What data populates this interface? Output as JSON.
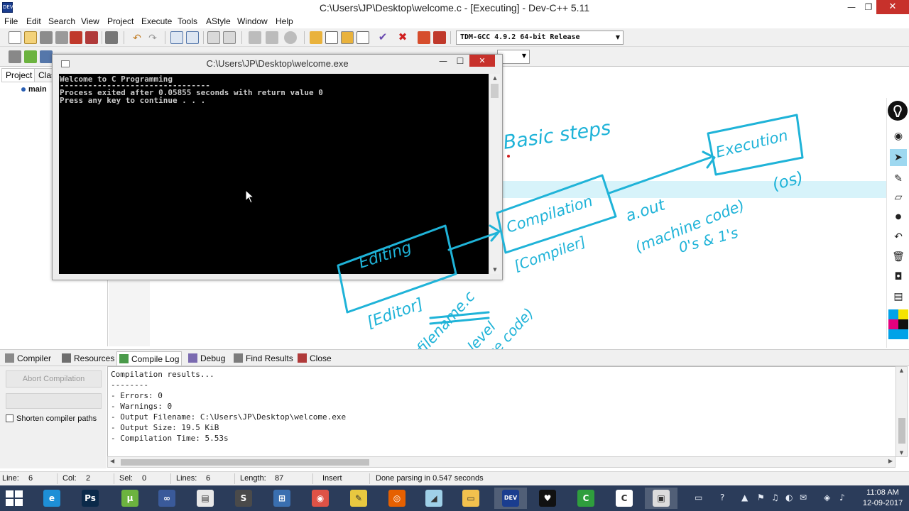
{
  "window": {
    "title": "C:\\Users\\JP\\Desktop\\welcome.c - [Executing] - Dev-C++ 5.11",
    "icon_label": "DEV",
    "minimize": "—",
    "maximize": "❐",
    "close": "✕"
  },
  "menu": [
    "File",
    "Edit",
    "Search",
    "View",
    "Project",
    "Execute",
    "Tools",
    "AStyle",
    "Window",
    "Help"
  ],
  "toolbar": {
    "compiler_select": "TDM-GCC 4.9.2 64-bit Release",
    "compiler_arrow": "▼",
    "second_arrow": "▼"
  },
  "left_panel": {
    "tabs": [
      "Project",
      "Clas"
    ],
    "tree_item": "main"
  },
  "console": {
    "title": "C:\\Users\\JP\\Desktop\\welcome.exe",
    "minimize": "—",
    "maximize": "☐",
    "close": "✕",
    "lines": [
      "Welcome to C Programming",
      "--------------------------------",
      "Process exited after 0.05855 seconds with return value 0",
      "Press any key to continue . . ."
    ]
  },
  "annotations": {
    "heading": "Basic steps",
    "editing": "Editing",
    "editor": "[Editor]",
    "compilation": "Compilation",
    "compiler": "[Compiler]",
    "execution": "Execution",
    "os": "(os)",
    "aout": "a.out",
    "machine_code": "(machine code)",
    "binary": "0's & 1's",
    "filename": "filename.c",
    "high_level": "(high-level",
    "source_code": "source code)",
    "ink_color": "#1fb3d8"
  },
  "pen_tools": {
    "icons": [
      "eye-icon",
      "pointer-icon",
      "pen-icon",
      "eraser-icon",
      "dot-icon",
      "undo-icon",
      "trash-icon",
      "camera-icon",
      "clipboard-icon"
    ],
    "swatches": [
      "#f5e400",
      "#e5007e",
      "#111111",
      "#00a2e8"
    ]
  },
  "bottom_tabs": [
    "Compiler",
    "Resources",
    "Compile Log",
    "Debug",
    "Find Results",
    "Close"
  ],
  "bottom_left": {
    "abort_label": "Abort Compilation",
    "shorten_label": "Shorten compiler paths",
    "progress_fraction": 0
  },
  "compile_log": [
    "Compilation results...",
    "--------",
    "- Errors: 0",
    "- Warnings: 0",
    "- Output Filename: C:\\Users\\JP\\Desktop\\welcome.exe",
    "- Output Size: 19.5 KiB",
    "- Compilation Time: 5.53s"
  ],
  "status": {
    "line_label": "Line:",
    "line_value": "6",
    "col_label": "Col:",
    "col_value": "2",
    "sel_label": "Sel:",
    "sel_value": "0",
    "lines_label": "Lines:",
    "lines_value": "6",
    "length_label": "Length:",
    "length_value": "87",
    "mode": "Insert",
    "message": "Done parsing in 0.547 seconds"
  },
  "taskbar": {
    "apps": [
      {
        "name": "internet-explorer",
        "glyph": "e",
        "color": "#1e8fd6"
      },
      {
        "name": "photoshop",
        "glyph": "Ps",
        "color": "#0b2a4a"
      },
      {
        "name": "utorrent",
        "glyph": "µ",
        "color": "#6cb33f"
      },
      {
        "name": "infinity-app",
        "glyph": "∞",
        "color": "#3a5a9a"
      },
      {
        "name": "chart-app",
        "glyph": "▤",
        "color": "#e8e8e8"
      },
      {
        "name": "sublime-text",
        "glyph": "S",
        "color": "#4a4a4a"
      },
      {
        "name": "network-app",
        "glyph": "⊞",
        "color": "#3a6fb0"
      },
      {
        "name": "chrome",
        "glyph": "◉",
        "color": "#de5246"
      },
      {
        "name": "pen-app",
        "glyph": "✎",
        "color": "#e8c840"
      },
      {
        "name": "firefox",
        "glyph": "◎",
        "color": "#e66000"
      },
      {
        "name": "sketch-app",
        "glyph": "◢",
        "color": "#9fd0e8"
      },
      {
        "name": "file-explorer",
        "glyph": "▭",
        "color": "#f2c14e"
      },
      {
        "name": "dev-cpp",
        "glyph": "DEV",
        "color": "#1a3d8f"
      },
      {
        "name": "epic-pen",
        "glyph": "♥",
        "color": "#111111"
      },
      {
        "name": "camtasia",
        "glyph": "C",
        "color": "#2f9e3d"
      },
      {
        "name": "camtasia-recorder",
        "glyph": "C",
        "color": "#ffffff"
      },
      {
        "name": "console-window",
        "glyph": "▣",
        "color": "#dcdcdc"
      }
    ],
    "tray": [
      "▭",
      "?",
      "▲",
      "⚑",
      "♫",
      "◐",
      "✉",
      "◈",
      "♪"
    ],
    "time": "11:08 AM",
    "date": "12-09-2017"
  }
}
